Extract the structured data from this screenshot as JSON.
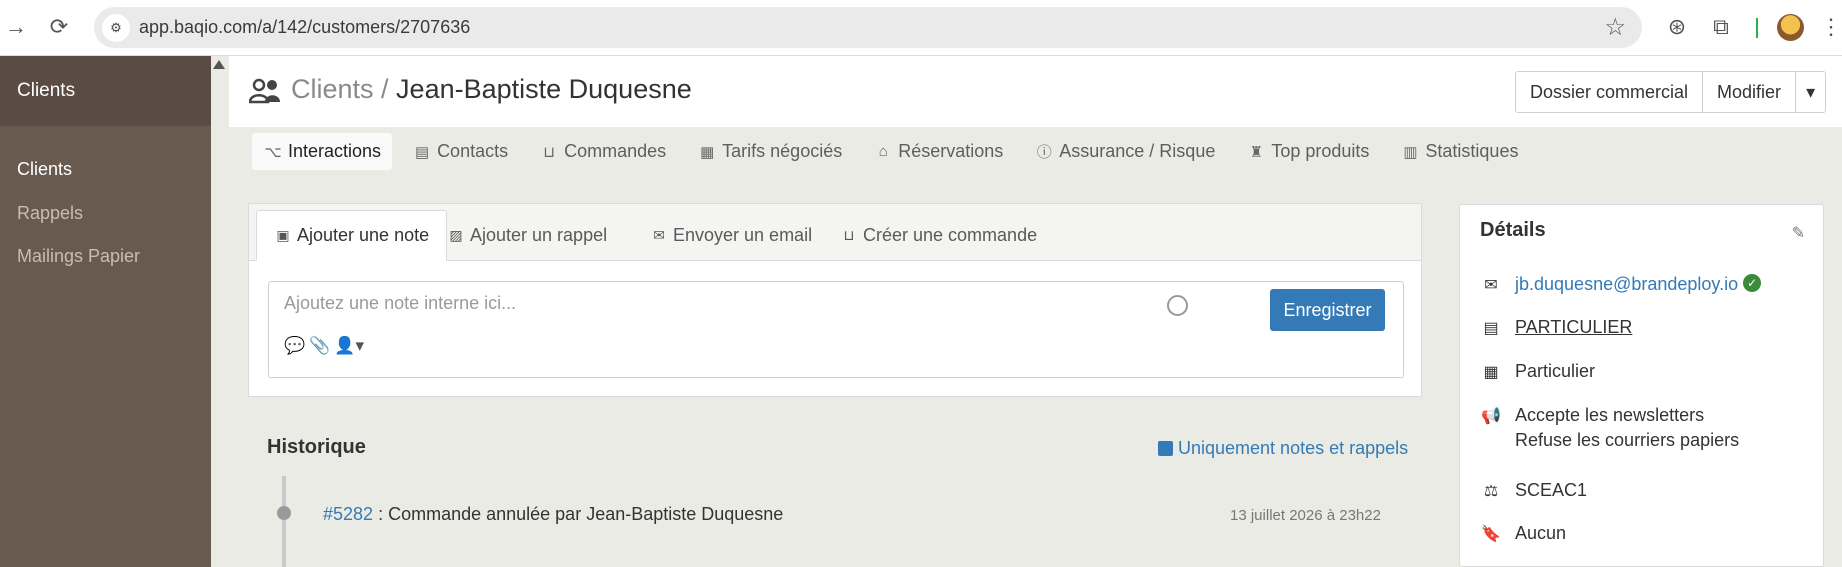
{
  "browser": {
    "url": "app.baqio.com/a/142/customers/2707636",
    "back_icon": "arrow-right-icon",
    "reload_icon": "reload-icon"
  },
  "sidebar": {
    "section_title": "Clients",
    "items": [
      {
        "label": "Clients",
        "active": true
      },
      {
        "label": "Rappels",
        "active": false
      },
      {
        "label": "Mailings Papier",
        "active": false
      }
    ]
  },
  "header": {
    "breadcrumb": "Clients",
    "separator": " / ",
    "customer_name": "Jean-Baptiste Duquesne",
    "buttons": {
      "dossier": "Dossier commercial",
      "modifier": "Modifier"
    }
  },
  "tabs": [
    {
      "label": "Interactions",
      "icon": "diagram-icon",
      "active": true
    },
    {
      "label": "Contacts",
      "icon": "id-card-icon",
      "active": false
    },
    {
      "label": "Commandes",
      "icon": "inbox-icon",
      "active": false
    },
    {
      "label": "Tarifs négociés",
      "icon": "calculator-icon",
      "active": false
    },
    {
      "label": "Réservations",
      "icon": "warehouse-icon",
      "active": false
    },
    {
      "label": "Assurance / Risque",
      "icon": "warning-circle-icon",
      "active": false
    },
    {
      "label": "Top produits",
      "icon": "ranking-icon",
      "active": false
    },
    {
      "label": "Statistiques",
      "icon": "bar-chart-icon",
      "active": false
    }
  ],
  "note_panel": {
    "tabs": [
      {
        "label": "Ajouter une note",
        "icon": "note-icon"
      },
      {
        "label": "Ajouter un rappel",
        "icon": "calendar-check-icon"
      },
      {
        "label": "Envoyer un email",
        "icon": "envelope-icon"
      },
      {
        "label": "Créer une commande",
        "icon": "inbox-icon"
      }
    ],
    "placeholder": "Ajoutez une note interne ici...",
    "save_label": "Enregistrer"
  },
  "history": {
    "title": "Historique",
    "filter_label": "Uniquement notes et rappels",
    "entries": [
      {
        "ref": "#5282",
        "text": " : Commande annulée par Jean-Baptiste Duquesne",
        "date": "13 juillet 2026 à 23h22"
      }
    ]
  },
  "details": {
    "title": "Détails",
    "email": "jb.duquesne@brandeploy.io",
    "type": "PARTICULIER",
    "pricing": "Particulier",
    "newsletter": "Accepte les newsletters",
    "paper": "Refuse les courriers papiers",
    "compliance": "SCEAC1",
    "bookmark": "Aucun"
  },
  "colors": {
    "sidebar_bg": "#695a50",
    "sidebar_head_bg": "#5b4c43",
    "primary": "#337ab7",
    "verified": "#3c8a3c"
  }
}
